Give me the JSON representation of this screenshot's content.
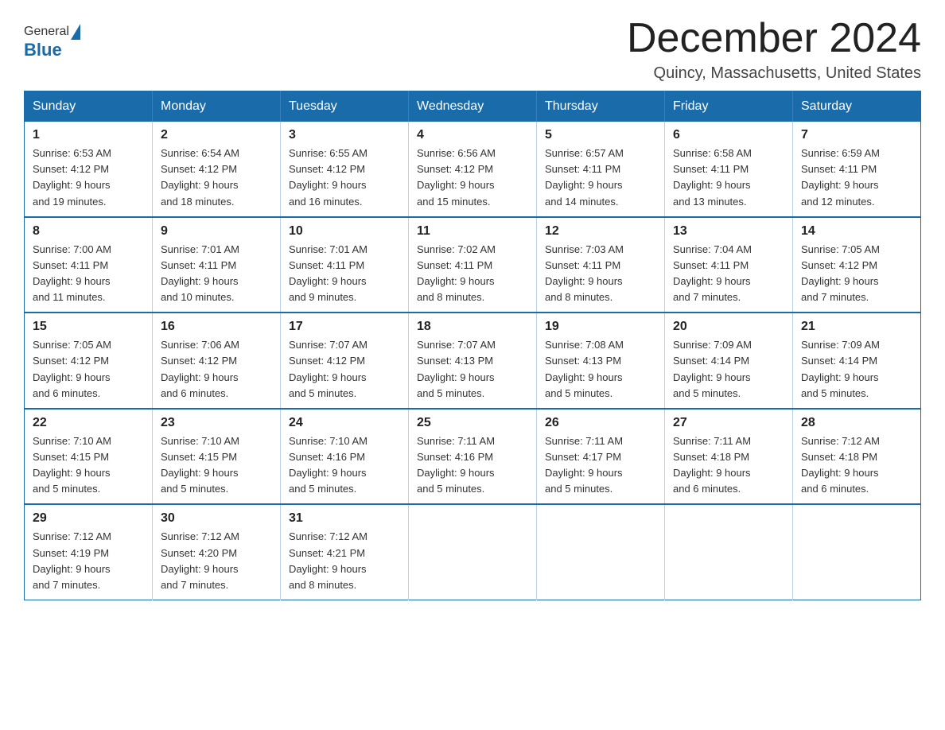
{
  "header": {
    "logo": {
      "general": "General",
      "blue": "Blue"
    },
    "title": "December 2024",
    "subtitle": "Quincy, Massachusetts, United States"
  },
  "weekdays": [
    "Sunday",
    "Monday",
    "Tuesday",
    "Wednesday",
    "Thursday",
    "Friday",
    "Saturday"
  ],
  "weeks": [
    [
      {
        "day": "1",
        "sunrise": "6:53 AM",
        "sunset": "4:12 PM",
        "daylight": "9 hours and 19 minutes."
      },
      {
        "day": "2",
        "sunrise": "6:54 AM",
        "sunset": "4:12 PM",
        "daylight": "9 hours and 18 minutes."
      },
      {
        "day": "3",
        "sunrise": "6:55 AM",
        "sunset": "4:12 PM",
        "daylight": "9 hours and 16 minutes."
      },
      {
        "day": "4",
        "sunrise": "6:56 AM",
        "sunset": "4:12 PM",
        "daylight": "9 hours and 15 minutes."
      },
      {
        "day": "5",
        "sunrise": "6:57 AM",
        "sunset": "4:11 PM",
        "daylight": "9 hours and 14 minutes."
      },
      {
        "day": "6",
        "sunrise": "6:58 AM",
        "sunset": "4:11 PM",
        "daylight": "9 hours and 13 minutes."
      },
      {
        "day": "7",
        "sunrise": "6:59 AM",
        "sunset": "4:11 PM",
        "daylight": "9 hours and 12 minutes."
      }
    ],
    [
      {
        "day": "8",
        "sunrise": "7:00 AM",
        "sunset": "4:11 PM",
        "daylight": "9 hours and 11 minutes."
      },
      {
        "day": "9",
        "sunrise": "7:01 AM",
        "sunset": "4:11 PM",
        "daylight": "9 hours and 10 minutes."
      },
      {
        "day": "10",
        "sunrise": "7:01 AM",
        "sunset": "4:11 PM",
        "daylight": "9 hours and 9 minutes."
      },
      {
        "day": "11",
        "sunrise": "7:02 AM",
        "sunset": "4:11 PM",
        "daylight": "9 hours and 8 minutes."
      },
      {
        "day": "12",
        "sunrise": "7:03 AM",
        "sunset": "4:11 PM",
        "daylight": "9 hours and 8 minutes."
      },
      {
        "day": "13",
        "sunrise": "7:04 AM",
        "sunset": "4:11 PM",
        "daylight": "9 hours and 7 minutes."
      },
      {
        "day": "14",
        "sunrise": "7:05 AM",
        "sunset": "4:12 PM",
        "daylight": "9 hours and 7 minutes."
      }
    ],
    [
      {
        "day": "15",
        "sunrise": "7:05 AM",
        "sunset": "4:12 PM",
        "daylight": "9 hours and 6 minutes."
      },
      {
        "day": "16",
        "sunrise": "7:06 AM",
        "sunset": "4:12 PM",
        "daylight": "9 hours and 6 minutes."
      },
      {
        "day": "17",
        "sunrise": "7:07 AM",
        "sunset": "4:12 PM",
        "daylight": "9 hours and 5 minutes."
      },
      {
        "day": "18",
        "sunrise": "7:07 AM",
        "sunset": "4:13 PM",
        "daylight": "9 hours and 5 minutes."
      },
      {
        "day": "19",
        "sunrise": "7:08 AM",
        "sunset": "4:13 PM",
        "daylight": "9 hours and 5 minutes."
      },
      {
        "day": "20",
        "sunrise": "7:09 AM",
        "sunset": "4:14 PM",
        "daylight": "9 hours and 5 minutes."
      },
      {
        "day": "21",
        "sunrise": "7:09 AM",
        "sunset": "4:14 PM",
        "daylight": "9 hours and 5 minutes."
      }
    ],
    [
      {
        "day": "22",
        "sunrise": "7:10 AM",
        "sunset": "4:15 PM",
        "daylight": "9 hours and 5 minutes."
      },
      {
        "day": "23",
        "sunrise": "7:10 AM",
        "sunset": "4:15 PM",
        "daylight": "9 hours and 5 minutes."
      },
      {
        "day": "24",
        "sunrise": "7:10 AM",
        "sunset": "4:16 PM",
        "daylight": "9 hours and 5 minutes."
      },
      {
        "day": "25",
        "sunrise": "7:11 AM",
        "sunset": "4:16 PM",
        "daylight": "9 hours and 5 minutes."
      },
      {
        "day": "26",
        "sunrise": "7:11 AM",
        "sunset": "4:17 PM",
        "daylight": "9 hours and 5 minutes."
      },
      {
        "day": "27",
        "sunrise": "7:11 AM",
        "sunset": "4:18 PM",
        "daylight": "9 hours and 6 minutes."
      },
      {
        "day": "28",
        "sunrise": "7:12 AM",
        "sunset": "4:18 PM",
        "daylight": "9 hours and 6 minutes."
      }
    ],
    [
      {
        "day": "29",
        "sunrise": "7:12 AM",
        "sunset": "4:19 PM",
        "daylight": "9 hours and 7 minutes."
      },
      {
        "day": "30",
        "sunrise": "7:12 AM",
        "sunset": "4:20 PM",
        "daylight": "9 hours and 7 minutes."
      },
      {
        "day": "31",
        "sunrise": "7:12 AM",
        "sunset": "4:21 PM",
        "daylight": "9 hours and 8 minutes."
      },
      null,
      null,
      null,
      null
    ]
  ],
  "labels": {
    "sunrise_prefix": "Sunrise: ",
    "sunset_prefix": "Sunset: ",
    "daylight_prefix": "Daylight: "
  }
}
